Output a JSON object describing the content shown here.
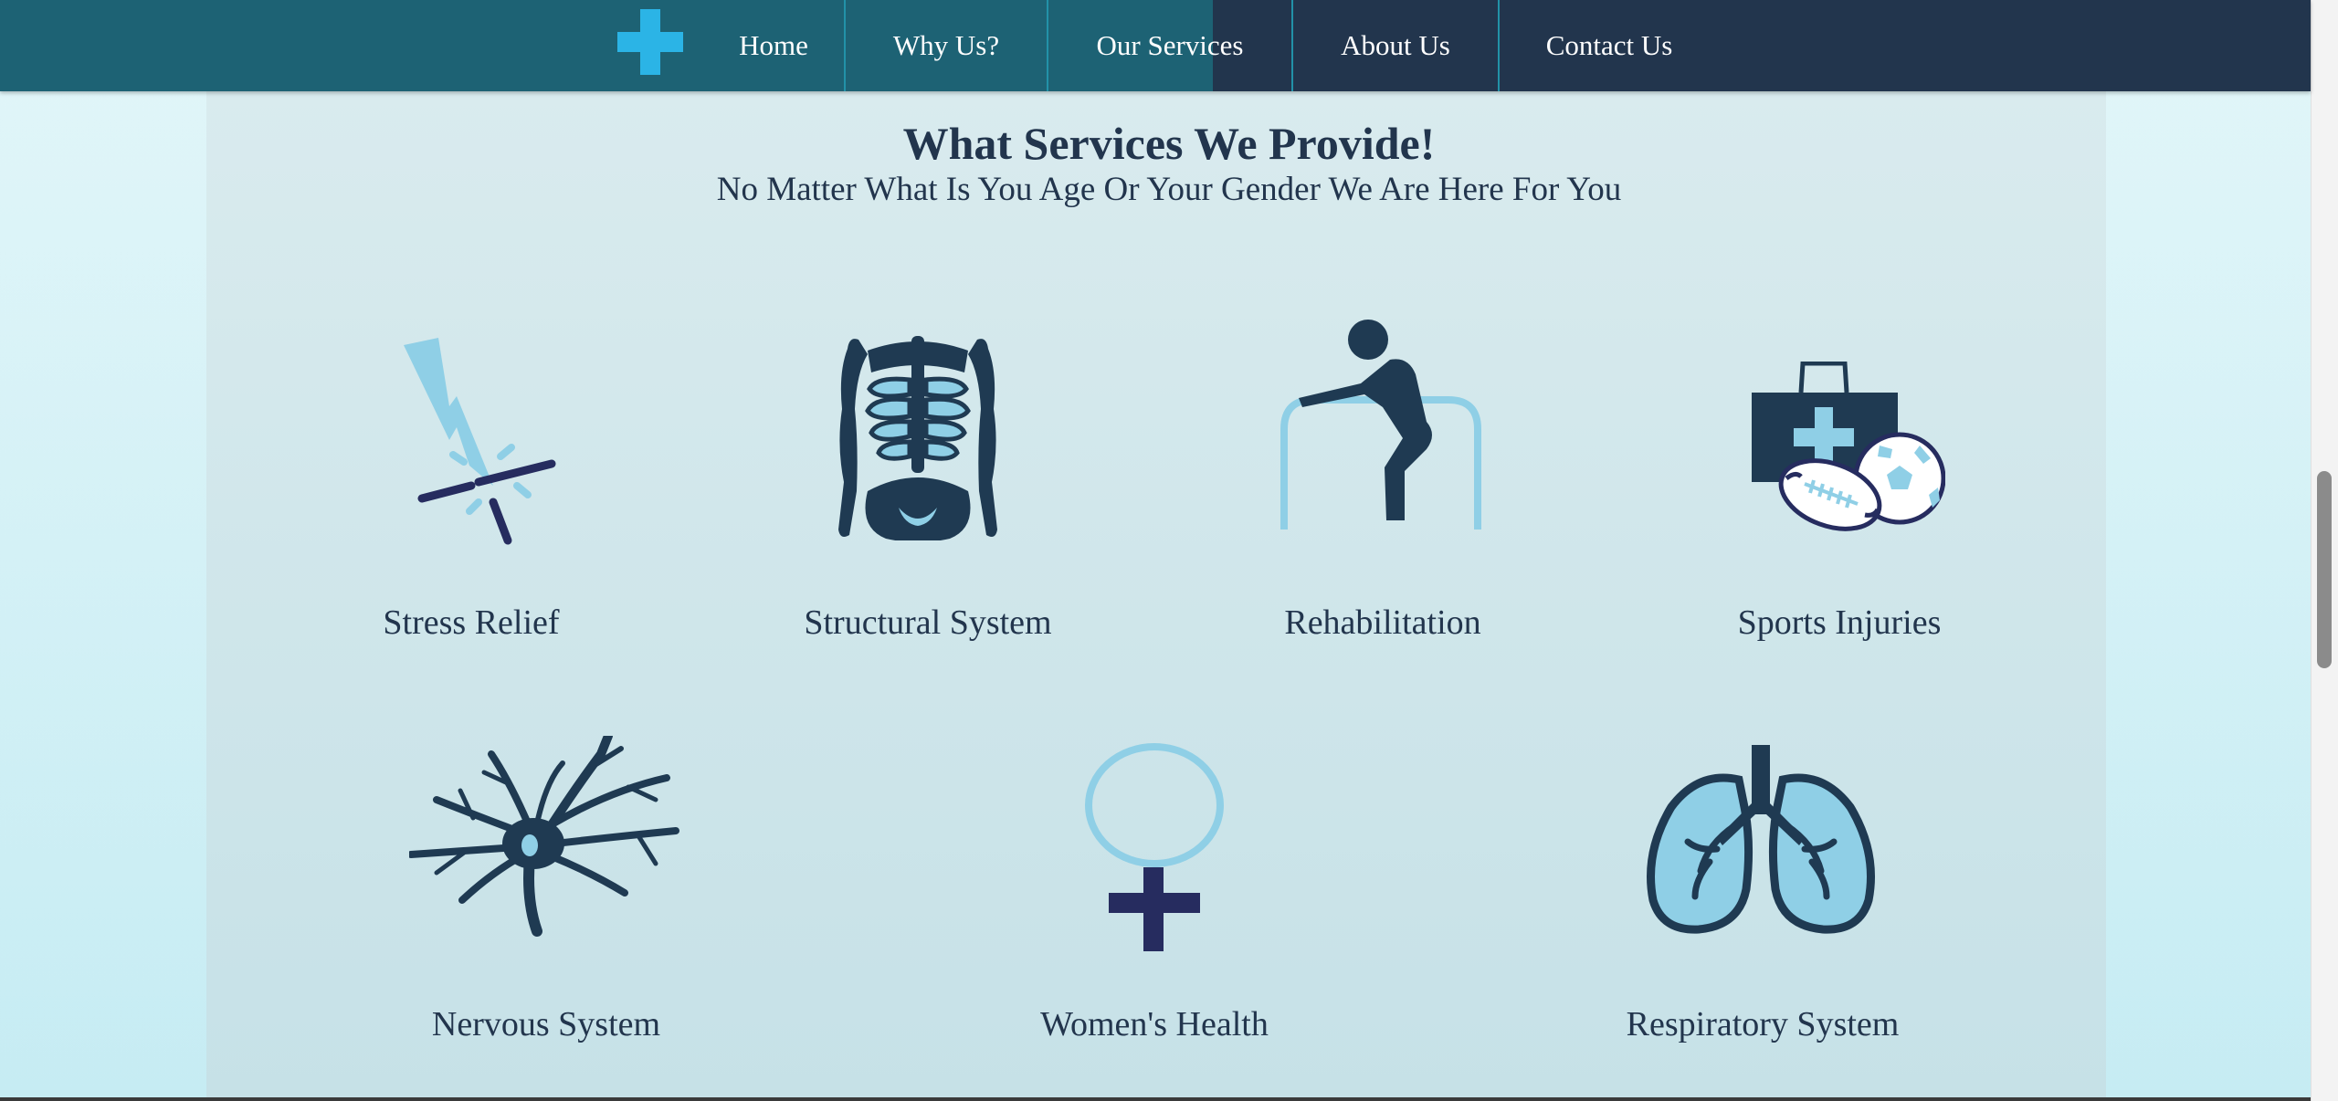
{
  "nav": {
    "items": [
      {
        "label": "Home"
      },
      {
        "label": "Why Us?"
      },
      {
        "label": "Our Services"
      },
      {
        "label": "About Us"
      },
      {
        "label": "Contact Us"
      }
    ]
  },
  "section": {
    "title": "What Services We Provide!",
    "subtitle": "No Matter What Is You Age Or Your Gender We Are Here For You"
  },
  "services": [
    {
      "label": "Stress Relief",
      "icon": "lightning-bolt-icon"
    },
    {
      "label": "Structural System",
      "icon": "skeleton-icon"
    },
    {
      "label": "Rehabilitation",
      "icon": "walker-person-icon"
    },
    {
      "label": "Sports Injuries",
      "icon": "first-aid-kit-balls-icon"
    },
    {
      "label": "Nervous System",
      "icon": "neuron-icon"
    },
    {
      "label": "Women's Health",
      "icon": "female-symbol-icon"
    },
    {
      "label": "Respiratory System",
      "icon": "lungs-icon"
    }
  ],
  "colors": {
    "nav_teal": "#1d6274",
    "nav_navy": "#22354d",
    "accent_blue": "#2bb4e6",
    "icon_dark": "#1f3a52",
    "icon_light": "#8fcfe6"
  }
}
